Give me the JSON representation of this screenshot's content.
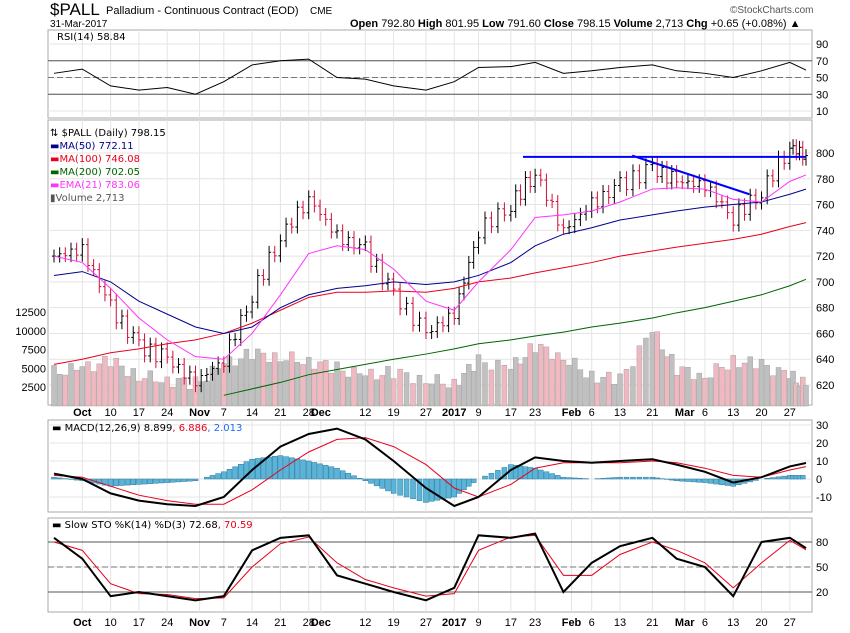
{
  "header": {
    "symbol": "$PALL",
    "name": "Palladium - Continuous Contract (EOD)",
    "exchange": "CME",
    "date": "31-Mar-2017",
    "copyright": "©StockCharts.com",
    "open_label": "Open",
    "open": "792.80",
    "high_label": "High",
    "high": "801.95",
    "low_label": "Low",
    "low": "791.60",
    "close_label": "Close",
    "close": "798.15",
    "volume_label": "Volume",
    "volume": "2,713",
    "chg_label": "Chg",
    "chg": "+0.65 (+0.08%)"
  },
  "legends": {
    "rsi": "RSI(14) 58.84",
    "price": "$PALL (Daily) 798.15",
    "ma50": "MA(50) 772.11",
    "ma100": "MA(100) 746.08",
    "ma200": "MA(200) 702.05",
    "ema21": "EMA(21) 783.06",
    "volume": "Volume 2,713",
    "macd_a": "MACD(12,26,9) 8.899",
    "macd_b": ", 6.886",
    "macd_c": ", 2.013",
    "sto_a": "Slow STO %K(14) %D(3) 72.68",
    "sto_b": ", 70.59"
  },
  "colors": {
    "ma50": "#00008b",
    "ma100": "#e8001c",
    "ma200": "#006400",
    "ema21": "#ff33ff",
    "trendline": "#0000ff",
    "macd_hist": "#5ab4d8",
    "vol_up": "#c0c0c0",
    "vol_down": "#f0b8c0"
  },
  "chart_data": {
    "type": "line",
    "x_axis_labels": [
      "Oct",
      "10",
      "17",
      "24",
      "Nov",
      "7",
      "14",
      "21",
      "28",
      "Dec",
      "12",
      "19",
      "27",
      "2017",
      "9",
      "17",
      "23",
      "Feb",
      "6",
      "13",
      "21",
      "Mar",
      "6",
      "13",
      "20",
      "27"
    ],
    "dates": [
      "2016-09-26",
      "2016-10-03",
      "2016-10-10",
      "2016-10-17",
      "2016-10-24",
      "2016-10-31",
      "2016-11-07",
      "2016-11-14",
      "2016-11-21",
      "2016-11-28",
      "2016-12-05",
      "2016-12-12",
      "2016-12-19",
      "2016-12-27",
      "2017-01-03",
      "2017-01-09",
      "2017-01-17",
      "2017-01-23",
      "2017-01-30",
      "2017-02-06",
      "2017-02-13",
      "2017-02-21",
      "2017-02-27",
      "2017-03-06",
      "2017-03-13",
      "2017-03-20",
      "2017-03-27",
      "2017-03-31"
    ],
    "price": {
      "yticks": [
        620,
        640,
        660,
        680,
        700,
        720,
        740,
        760,
        780,
        800
      ],
      "close": [
        720,
        725,
        680,
        650,
        640,
        622,
        640,
        690,
        735,
        765,
        735,
        725,
        690,
        660,
        675,
        740,
        760,
        785,
        740,
        760,
        775,
        788,
        778,
        775,
        750,
        770,
        805,
        798
      ],
      "ma50": [
        705,
        708,
        700,
        685,
        675,
        665,
        660,
        665,
        680,
        690,
        695,
        697,
        700,
        698,
        700,
        705,
        715,
        728,
        737,
        742,
        748,
        752,
        755,
        758,
        760,
        762,
        768,
        772
      ],
      "ma100": [
        636,
        640,
        645,
        648,
        652,
        655,
        660,
        668,
        678,
        688,
        692,
        692,
        693,
        692,
        695,
        700,
        703,
        707,
        711,
        715,
        720,
        724,
        727,
        730,
        733,
        737,
        743,
        746
      ],
      "ma200": [
        null,
        null,
        null,
        null,
        null,
        null,
        612,
        617,
        622,
        628,
        632,
        636,
        640,
        644,
        648,
        652,
        655,
        658,
        661,
        665,
        668,
        672,
        676,
        680,
        685,
        690,
        697,
        702
      ],
      "ema21": [
        720,
        715,
        695,
        672,
        655,
        642,
        640,
        660,
        690,
        722,
        728,
        725,
        710,
        685,
        678,
        700,
        725,
        750,
        752,
        755,
        762,
        772,
        773,
        772,
        764,
        762,
        778,
        783
      ],
      "trendlines": [
        {
          "from": [
            "2017-01-20",
            797
          ],
          "to": [
            "2017-03-31",
            797
          ]
        },
        {
          "from": [
            "2017-02-16",
            798
          ],
          "to": [
            "2017-03-17",
            768
          ]
        }
      ]
    },
    "volume": {
      "yticks": [
        2500,
        5000,
        7500,
        10000,
        12500
      ],
      "values": [
        4500,
        5000,
        6000,
        4000,
        3500,
        3000,
        5500,
        7000,
        6500,
        6000,
        5000,
        4000,
        4500,
        3500,
        3000,
        6000,
        5000,
        8000,
        6500,
        4000,
        3500,
        10000,
        5000,
        4000,
        6000,
        5500,
        4000,
        2713
      ]
    },
    "rsi": {
      "yticks": [
        10,
        30,
        50,
        70,
        90
      ],
      "values": [
        55,
        60,
        40,
        35,
        38,
        30,
        45,
        65,
        70,
        72,
        50,
        48,
        40,
        35,
        45,
        62,
        63,
        68,
        55,
        58,
        62,
        65,
        58,
        55,
        50,
        58,
        68,
        58.84
      ]
    },
    "macd": {
      "yticks": [
        -10,
        0,
        10,
        20,
        30
      ],
      "macd": [
        3,
        0,
        -8,
        -12,
        -14,
        -15,
        -10,
        5,
        18,
        25,
        28,
        22,
        10,
        -5,
        -15,
        -10,
        5,
        12,
        10,
        9,
        10,
        11,
        8,
        4,
        -2,
        1,
        7,
        8.899
      ],
      "signal": [
        2,
        1,
        -4,
        -9,
        -12,
        -14,
        -14,
        -6,
        5,
        15,
        22,
        23,
        18,
        8,
        -5,
        -10,
        -3,
        6,
        9,
        9,
        9,
        10,
        9,
        6,
        2,
        1,
        5,
        6.886
      ]
    },
    "sto": {
      "yticks": [
        20,
        50,
        80
      ],
      "k": [
        85,
        60,
        15,
        20,
        15,
        10,
        15,
        70,
        85,
        88,
        40,
        30,
        20,
        10,
        25,
        88,
        85,
        90,
        20,
        55,
        75,
        85,
        60,
        50,
        15,
        80,
        85,
        72.68
      ],
      "d": [
        80,
        70,
        30,
        18,
        17,
        12,
        13,
        50,
        78,
        86,
        55,
        35,
        25,
        15,
        18,
        70,
        86,
        88,
        40,
        40,
        65,
        80,
        70,
        55,
        25,
        55,
        82,
        70.59
      ]
    }
  }
}
